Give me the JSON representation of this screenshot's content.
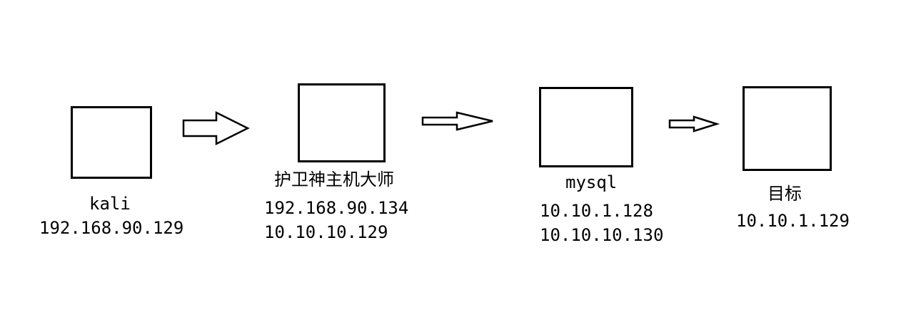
{
  "diagram": {
    "nodes": [
      {
        "id": "kali",
        "name": "kali",
        "ips": [
          "192.168.90.129"
        ]
      },
      {
        "id": "host-master",
        "name": "护卫神主机大师",
        "ips": [
          "192.168.90.134",
          "10.10.10.129"
        ]
      },
      {
        "id": "mysql",
        "name": "mysql",
        "ips": [
          "10.10.1.128",
          "10.10.10.130"
        ]
      },
      {
        "id": "target",
        "name": "目标",
        "ips": [
          "10.10.1.129"
        ]
      }
    ],
    "edges": [
      {
        "from": "kali",
        "to": "host-master"
      },
      {
        "from": "host-master",
        "to": "mysql"
      },
      {
        "from": "mysql",
        "to": "target"
      }
    ],
    "colors": {
      "stroke": "#000000",
      "fill": "#ffffff"
    }
  }
}
